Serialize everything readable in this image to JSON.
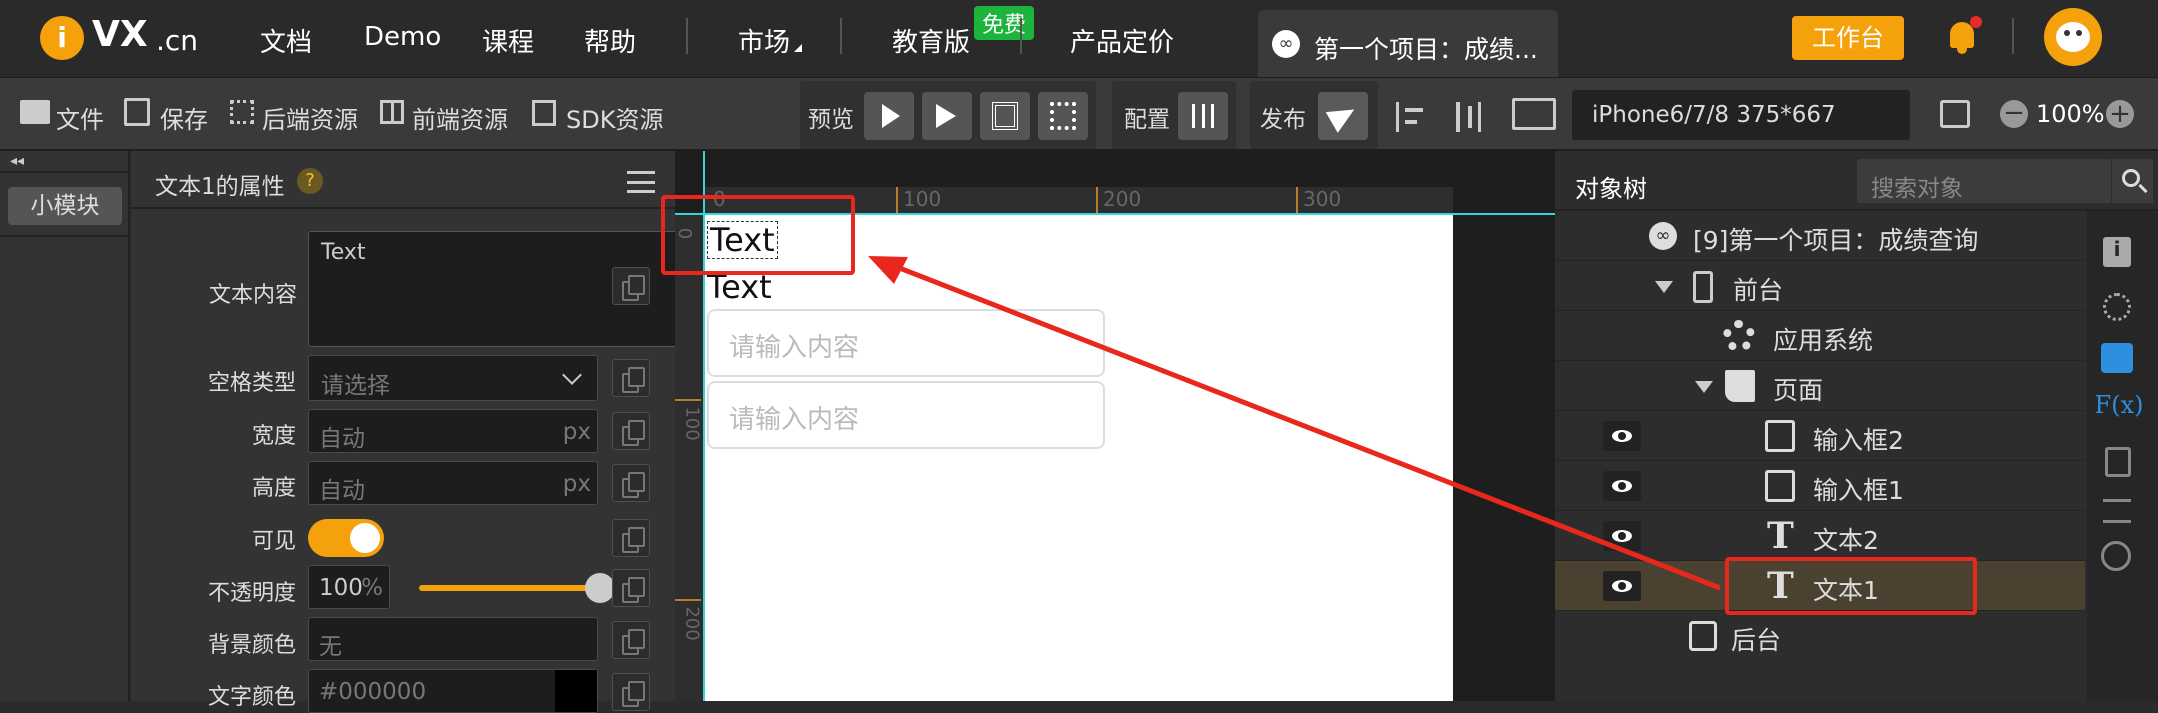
{
  "topbar": {
    "logo_i": "i",
    "logo_text": "VX",
    "logo_suffix": ".cn",
    "nav": [
      "文档",
      "Demo",
      "课程",
      "帮助",
      "市场",
      "教育版",
      "产品定价"
    ],
    "free_badge": "免费",
    "project_tab": "第一个项目：成绩...",
    "workbench_button": "工作台",
    "colors": {
      "brand_orange": "#f5a10b",
      "badge_green": "#1cb43c"
    }
  },
  "toolbar": {
    "file": "文件",
    "save": "保存",
    "backend_res": "后端资源",
    "frontend_res": "前端资源",
    "sdk_res": "SDK资源",
    "preview": "预览",
    "config": "配置",
    "publish": "发布",
    "device": "iPhone6/7/8 375*667",
    "zoom": "100%"
  },
  "left": {
    "collapse": "◂◂",
    "module_button": "小模块"
  },
  "props": {
    "title": "文本1的属性",
    "help": "?",
    "fields": {
      "text_label": "文本内容",
      "text_value": "Text",
      "space_label": "空格类型",
      "space_placeholder": "请选择",
      "width_label": "宽度",
      "width_value": "自动",
      "height_label": "高度",
      "height_value": "自动",
      "unit": "px",
      "visible_label": "可见",
      "visible": true,
      "opacity_label": "不透明度",
      "opacity_value": "100",
      "opacity_unit": "%",
      "opacity_level": 1.0,
      "bg_label": "背景颜色",
      "bg_value": "无",
      "color_label": "文字颜色",
      "color_value": "#000000"
    }
  },
  "canvas": {
    "ruler_ticks": [
      "0",
      "100",
      "200",
      "300"
    ],
    "vruler_ticks": [
      "0",
      "100",
      "200"
    ],
    "text1": "Text",
    "text2": "Text",
    "input1_placeholder": "请输入内容",
    "input2_placeholder": "请输入内容"
  },
  "objtree": {
    "title": "对象树",
    "search_placeholder": "搜索对象",
    "items": {
      "project": "[9]第一个项目：成绩查询",
      "frontend": "前台",
      "appsys": "应用系统",
      "page": "页面",
      "input2": "输入框2",
      "input1": "输入框1",
      "text2": "文本2",
      "text1": "文本1",
      "backend": "后台"
    }
  },
  "sidebar": {
    "fx": "F(x)"
  }
}
